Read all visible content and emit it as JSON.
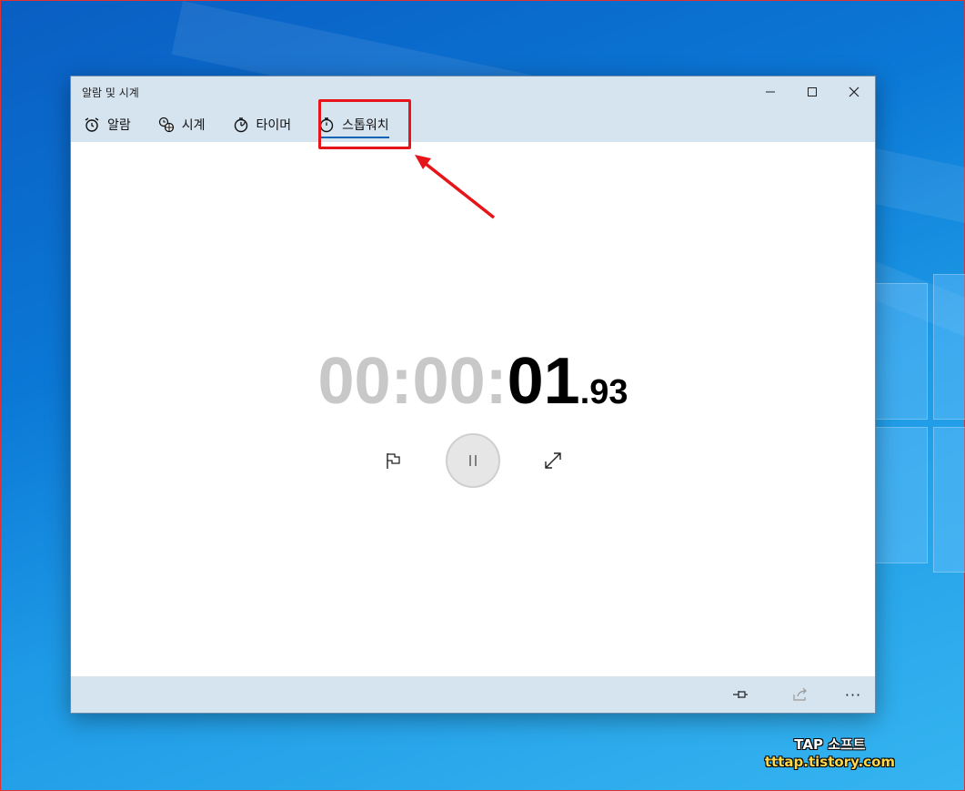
{
  "window": {
    "title": "알람 및 시계",
    "minimize_label": "—",
    "maximize_label": "☐",
    "close_label": "✕"
  },
  "tabs": [
    {
      "label": "알람",
      "icon": "alarm-clock-icon"
    },
    {
      "label": "시계",
      "icon": "world-clock-icon"
    },
    {
      "label": "타이머",
      "icon": "timer-icon"
    },
    {
      "label": "스톱워치",
      "icon": "stopwatch-icon",
      "active": true
    }
  ],
  "stopwatch": {
    "hours_minutes": "00:00:",
    "seconds": "01",
    "milliseconds": ".93",
    "pause_label": "II"
  },
  "footer": {
    "more_label": "···"
  },
  "watermark": {
    "line1": "TAP 소프트",
    "line2": "tttap.tistory.com"
  },
  "colors": {
    "accent": "#0a63b5",
    "highlight": "#e6151a",
    "chrome": "#d6e4f0"
  }
}
